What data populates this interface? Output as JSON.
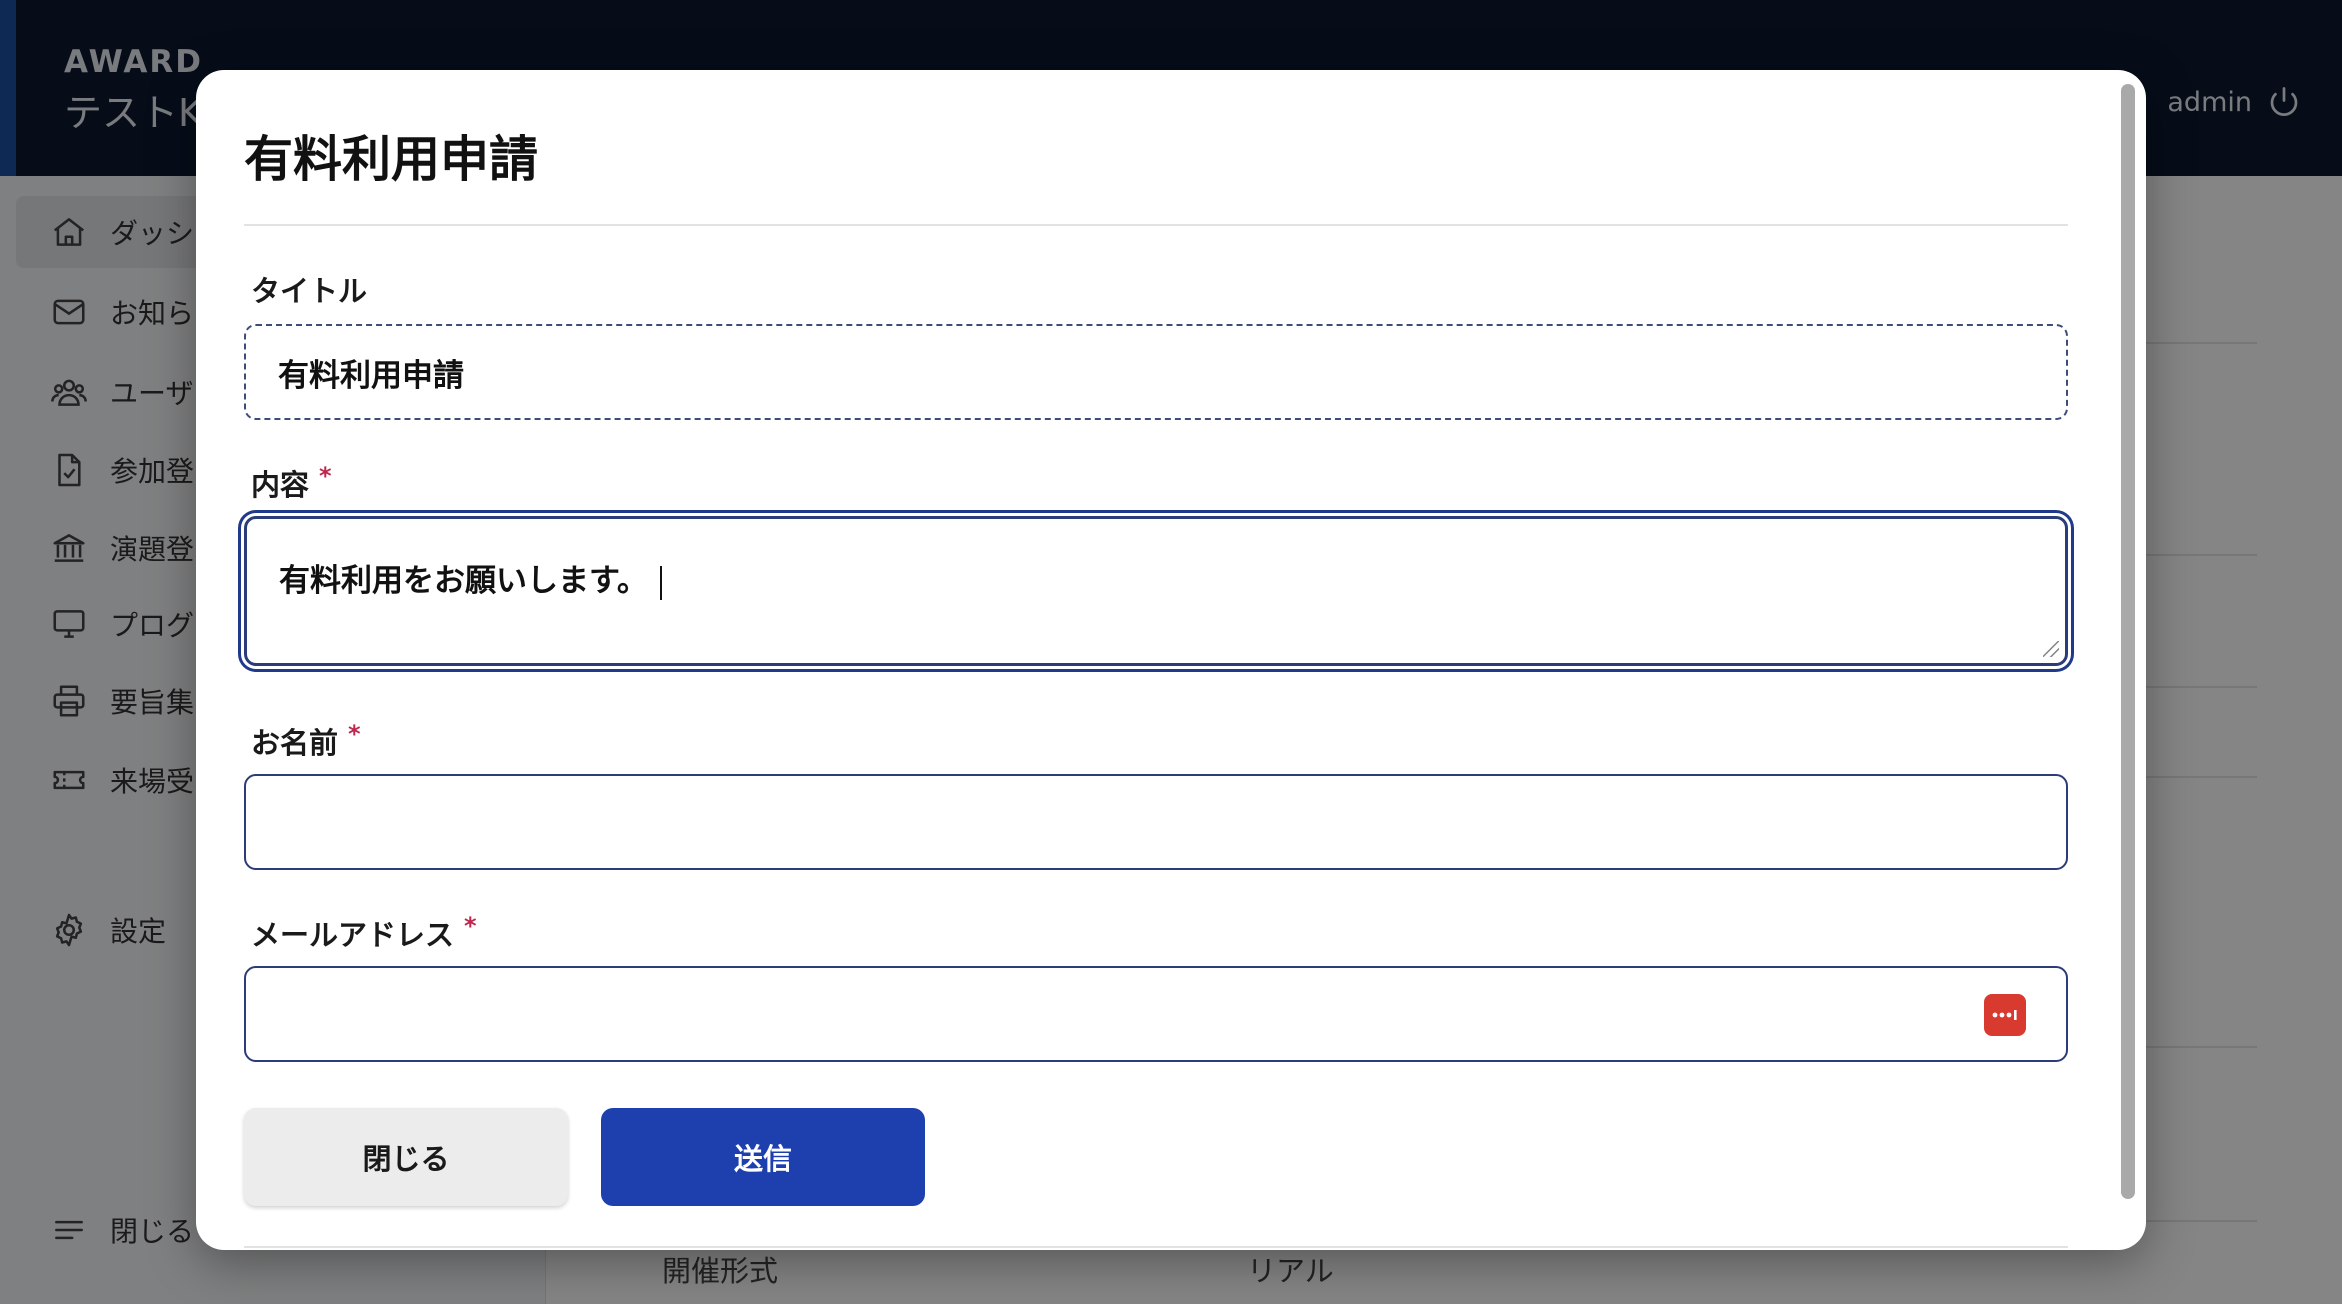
{
  "header": {
    "logo": "AWARD",
    "subtitle": "テストK",
    "user": "admin"
  },
  "sidebar": {
    "items": [
      {
        "label": "ダッシ",
        "icon": "home-icon"
      },
      {
        "label": "お知ら",
        "icon": "mail-icon"
      },
      {
        "label": "ユーザ",
        "icon": "users-icon"
      },
      {
        "label": "参加登",
        "icon": "document-check-icon"
      },
      {
        "label": "演題登",
        "icon": "bank-icon"
      },
      {
        "label": "プログ",
        "icon": "monitor-icon"
      },
      {
        "label": "要旨集",
        "icon": "printer-icon"
      },
      {
        "label": "来場受",
        "icon": "ticket-icon"
      }
    ],
    "settings_label": "設定",
    "close_label": "閉じる"
  },
  "main": {
    "row_label": "開催形式",
    "row_value": "リアル"
  },
  "modal": {
    "title": "有料利用申請",
    "title_field": {
      "label": "タイトル",
      "value": "有料利用申請"
    },
    "content_field": {
      "label": "内容",
      "required": "*",
      "value": "有料利用をお願いします。"
    },
    "name_field": {
      "label": "お名前",
      "required": "*",
      "value": ""
    },
    "email_field": {
      "label": "メールアドレス",
      "required": "*",
      "value": ""
    },
    "close_button": "閉じる",
    "submit_button": "送信"
  }
}
